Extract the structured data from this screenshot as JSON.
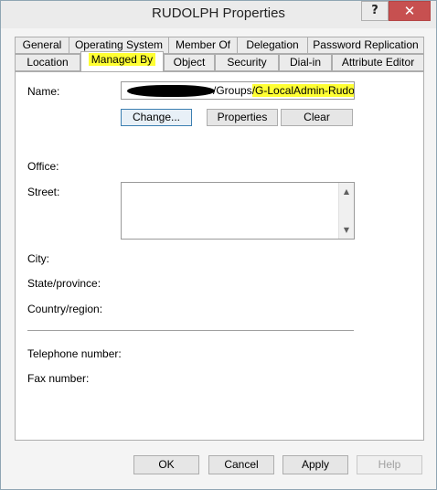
{
  "window": {
    "title": "RUDOLPH Properties",
    "help_label": "?",
    "close_label": "✕"
  },
  "tabs_row1": [
    "General",
    "Operating System",
    "Member Of",
    "Delegation",
    "Password Replication"
  ],
  "tabs_row2": [
    "Location",
    "Managed By",
    "Object",
    "Security",
    "Dial-in",
    "Attribute Editor"
  ],
  "active_tab": "Managed By",
  "managed_by": {
    "name_label": "Name:",
    "name_value_plain": "/Groups",
    "name_value_highlight": "/G-LocalAdmin-Rudolph",
    "change_button": "Change...",
    "properties_button": "Properties",
    "clear_button": "Clear",
    "office_label": "Office:",
    "street_label": "Street:",
    "city_label": "City:",
    "state_label": "State/province:",
    "country_label": "Country/region:",
    "telephone_label": "Telephone number:",
    "fax_label": "Fax number:"
  },
  "footer": {
    "ok": "OK",
    "cancel": "Cancel",
    "apply": "Apply",
    "help": "Help"
  },
  "colors": {
    "highlight": "#ffff33",
    "close_button": "#c75050"
  }
}
